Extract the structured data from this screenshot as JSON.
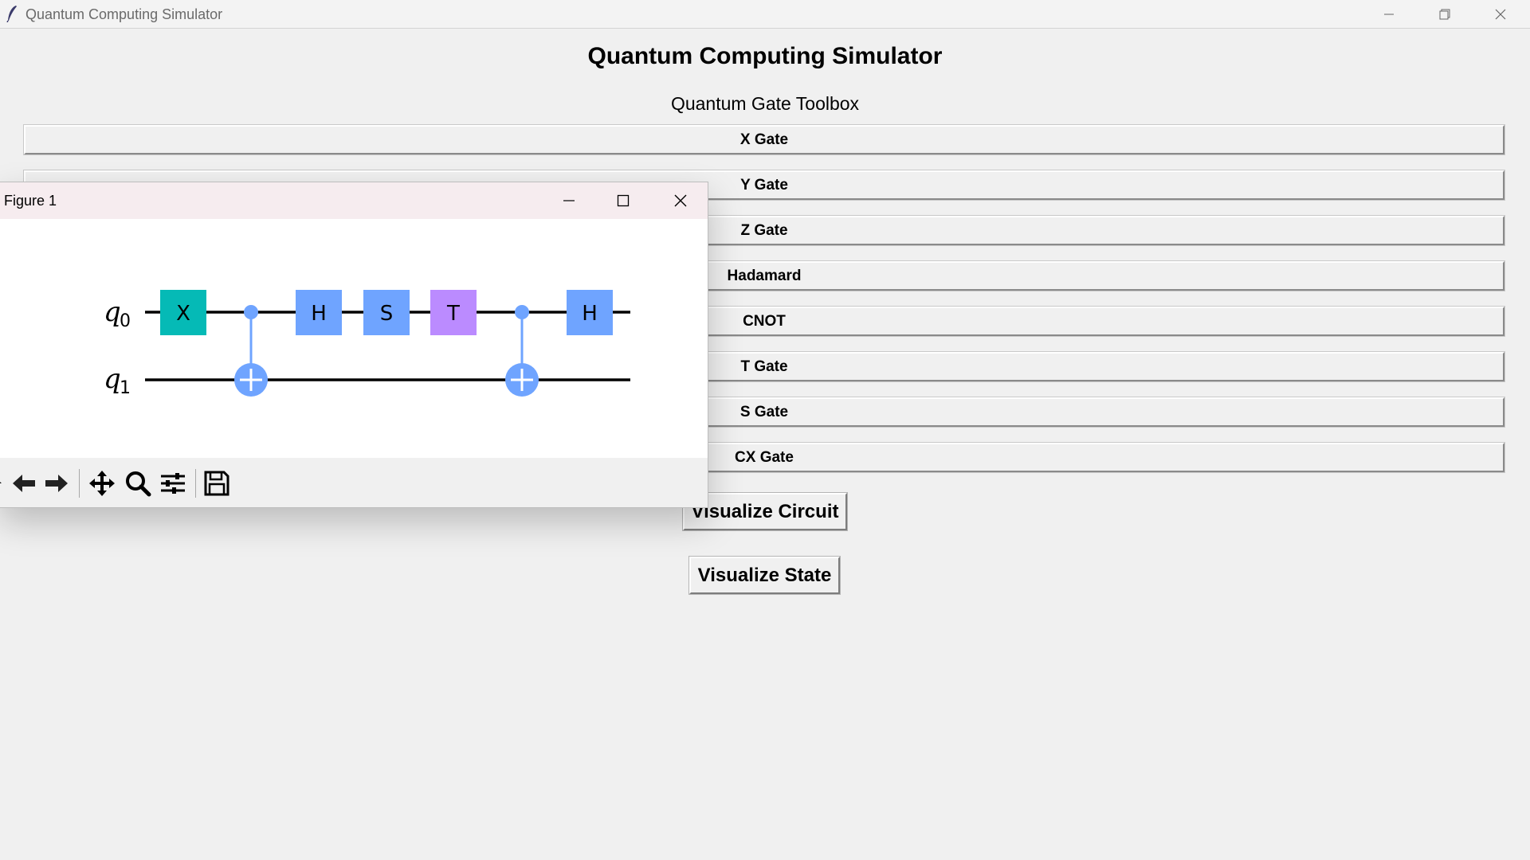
{
  "window": {
    "title": "Quantum Computing Simulator",
    "controls": [
      "minimize",
      "restore",
      "close"
    ]
  },
  "app": {
    "heading": "Quantum Computing Simulator",
    "toolbox_label": "Quantum Gate Toolbox",
    "gate_buttons": [
      "X Gate",
      "Y Gate",
      "Z Gate",
      "Hadamard",
      "CNOT",
      "T Gate",
      "S Gate",
      "CX Gate"
    ],
    "visualize_circuit_label": "Visualize Circuit",
    "visualize_state_label": "Visualize State"
  },
  "figure": {
    "title": "Figure 1",
    "qubits": [
      "q",
      "q"
    ],
    "qubit_indices": [
      "0",
      "1"
    ],
    "gates": [
      "X",
      "H",
      "S",
      "T",
      "H"
    ],
    "colors": {
      "x_gate": "#05bab6",
      "h_gate": "#6fa4ff",
      "s_gate": "#6fa4ff",
      "t_gate": "#bb8bff",
      "control": "#6fa4ff",
      "wire": "#000000"
    },
    "toolbar_icons": [
      "home-icon",
      "back-arrow-icon",
      "forward-arrow-icon",
      "pan-icon",
      "zoom-icon",
      "configure-subplots-icon",
      "save-icon"
    ]
  }
}
